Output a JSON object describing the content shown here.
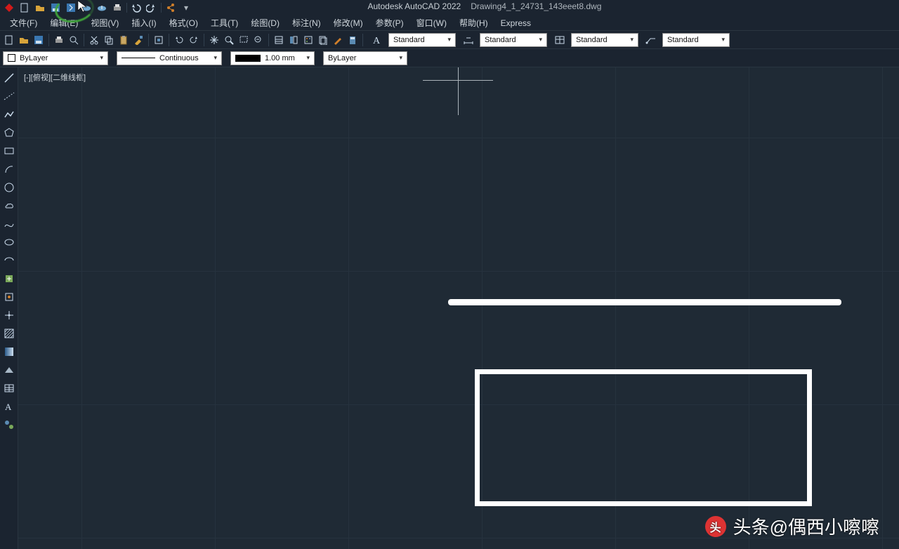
{
  "app": {
    "name": "Autodesk AutoCAD 2022",
    "filename": "Drawing4_1_24731_143eeet8.dwg"
  },
  "menu": {
    "file": "文件(F)",
    "edit": "编辑(E)",
    "view": "视图(V)",
    "insert": "插入(I)",
    "format": "格式(O)",
    "tools": "工具(T)",
    "draw": "绘图(D)",
    "dimension": "标注(N)",
    "modify": "修改(M)",
    "parametric": "参数(P)",
    "window": "窗口(W)",
    "help": "帮助(H)",
    "express": "Express"
  },
  "styles": {
    "text": "Standard",
    "dim": "Standard",
    "table": "Standard",
    "mleader": "Standard"
  },
  "props": {
    "layer": "ByLayer",
    "linetype": "Continuous",
    "lineweight": "1.00 mm",
    "plotstyle": "ByLayer"
  },
  "viewport": {
    "label": "[-][俯视][二维线框]"
  },
  "watermark": {
    "text": "头条@偶西小嚓嚓"
  }
}
